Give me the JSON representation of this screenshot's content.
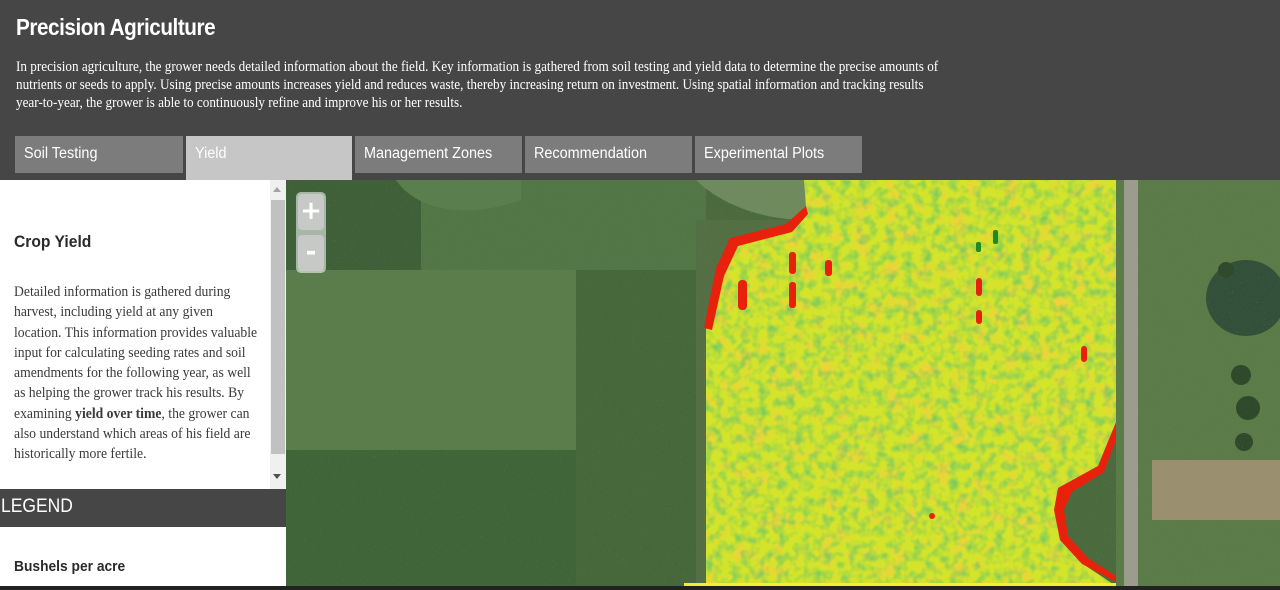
{
  "header": {
    "title": "Precision Agriculture",
    "intro": "In precision agriculture, the grower needs detailed information about the field. Key information is gathered from soil testing and yield data to determine the precise amounts of nutrients or seeds to apply. Using precise amounts increases yield and reduces waste, thereby increasing return on investment. Using spatial information and tracking results year-to-year, the grower is able to continuously refine and improve his or her results."
  },
  "tabs": [
    {
      "label": "Soil Testing",
      "active": false
    },
    {
      "label": "Yield",
      "active": true
    },
    {
      "label": "Management Zones",
      "active": false
    },
    {
      "label": "Recommendation",
      "active": false
    },
    {
      "label": "Experimental Plots",
      "active": false
    }
  ],
  "sidebar": {
    "section_title": "Crop Yield",
    "body": {
      "intro": "Detailed information is gathered during harvest, including yield at any given location.  This information provides valuable input for calculating seeding rates and soil amendments for the following year, as well as helping the grower track his results.  By examining ",
      "emphasis": "yield over time",
      "outro": ", the grower can also understand which areas of his field are historically more fertile."
    },
    "legend_title": "LEGEND",
    "legend_subtitle": "Bushels per acre"
  },
  "map": {
    "zoom_in_label": "+",
    "zoom_out_label": "-",
    "yield_colors": {
      "low": "#e8210c",
      "mid": "#e6ec22",
      "high": "#1f8a22"
    }
  },
  "colors": {
    "header_bg": "#464646",
    "tab": "#7c7c7c",
    "tab_active": "#c6c6c6"
  }
}
